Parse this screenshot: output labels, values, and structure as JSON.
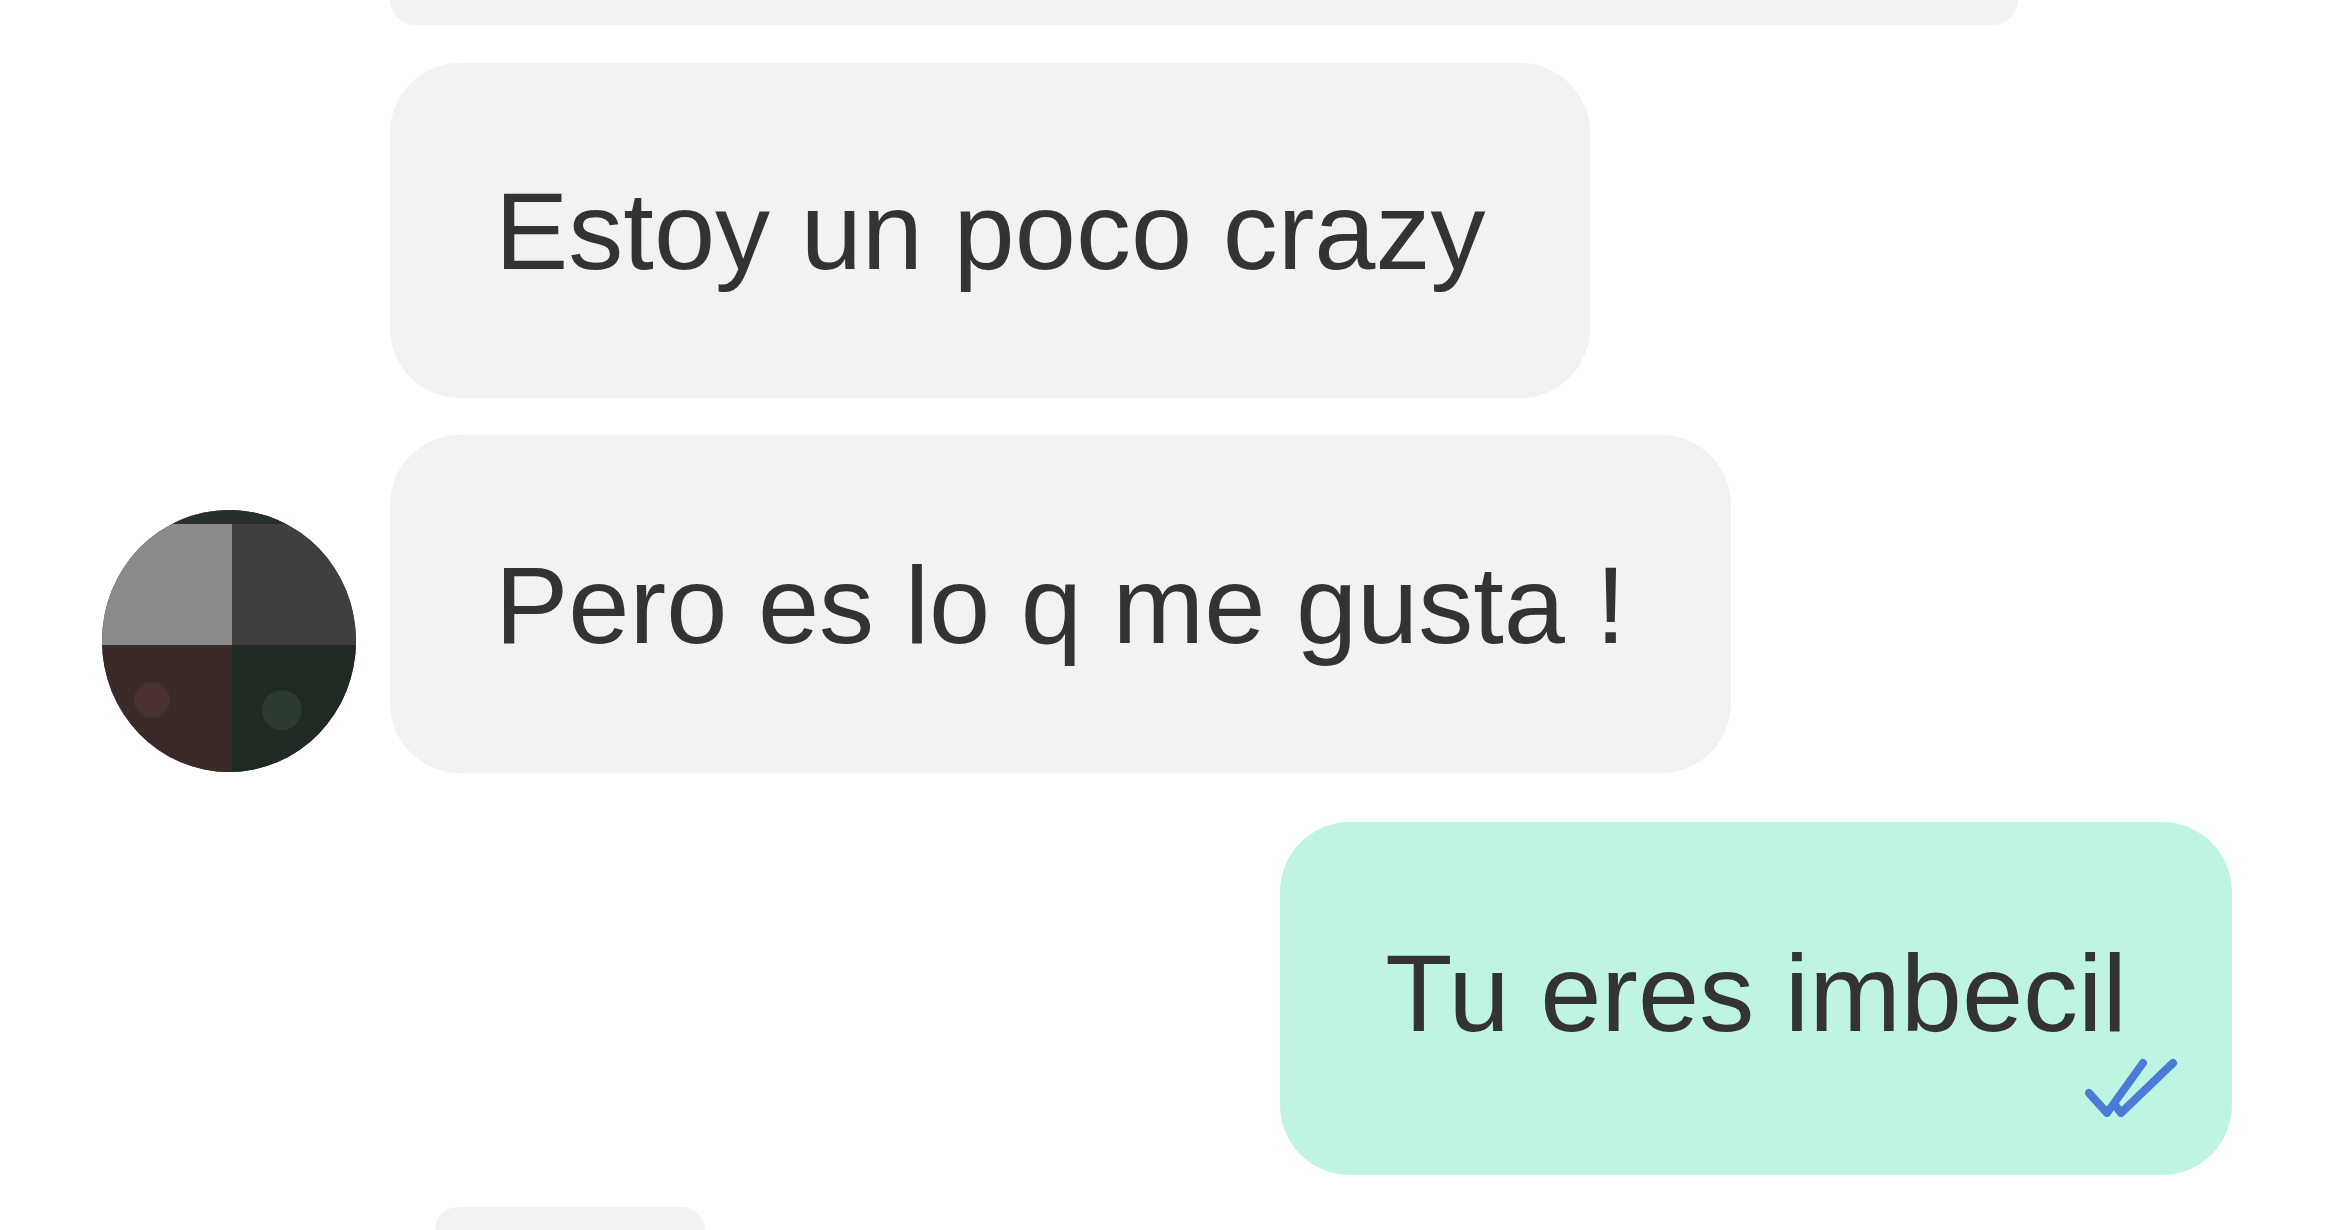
{
  "messages": [
    {
      "kind": "cut-top",
      "outgoing": false
    },
    {
      "kind": "text",
      "outgoing": false,
      "avatar": false,
      "text": "Estoy un poco crazy"
    },
    {
      "kind": "text",
      "outgoing": false,
      "avatar": true,
      "text": "Pero es lo q me gusta !"
    },
    {
      "kind": "text",
      "outgoing": true,
      "text": "Tu eres imbecil",
      "read": true
    },
    {
      "kind": "cut-bottom",
      "outgoing": false
    }
  ]
}
